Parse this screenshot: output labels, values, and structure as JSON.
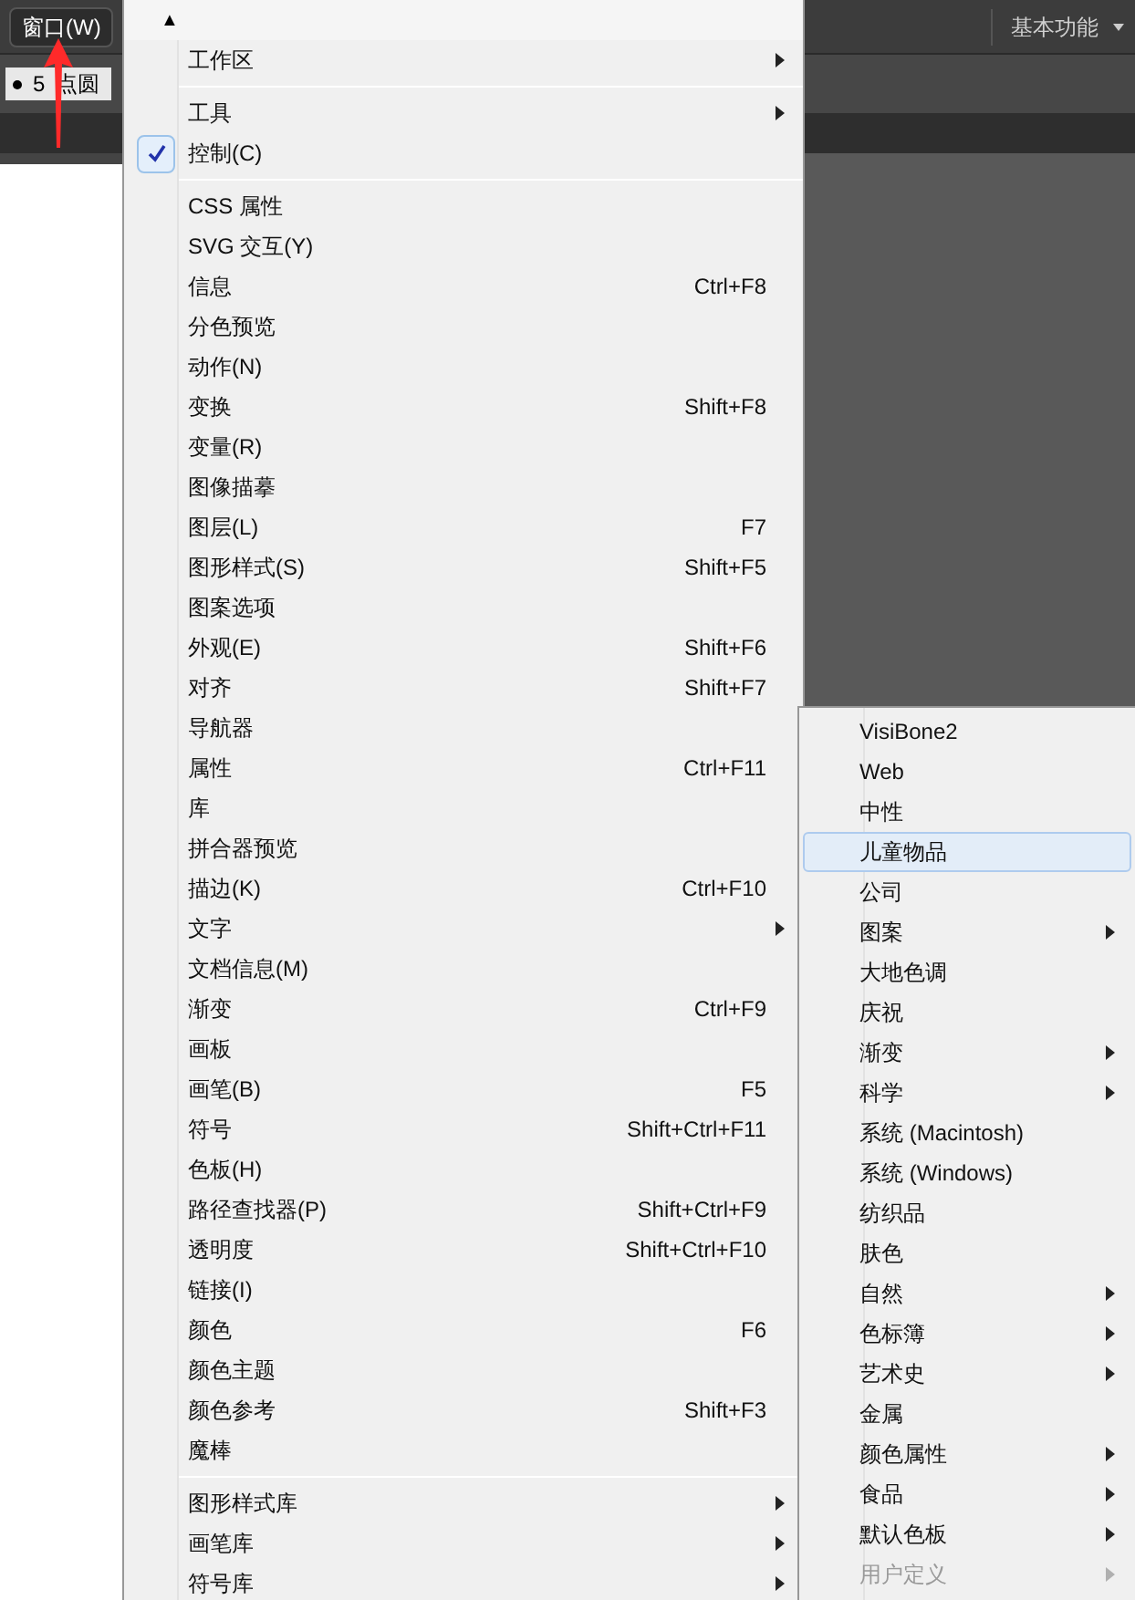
{
  "menu_button": {
    "label": "窗口(W)"
  },
  "control_field": {
    "size": "5",
    "shape": "点圆"
  },
  "workspace": {
    "label": "基本功能"
  },
  "menu": {
    "scroll_up": "▲",
    "sections": [
      {
        "items": [
          {
            "label": "工作区",
            "kind": "submenu"
          }
        ]
      },
      {
        "items": [
          {
            "label": "工具",
            "kind": "submenu"
          },
          {
            "label": "控制(C)",
            "kind": "item",
            "checked": true
          }
        ]
      },
      {
        "items": [
          {
            "label": "CSS 属性",
            "kind": "item",
            "checked": false
          },
          {
            "label": "SVG 交互(Y)",
            "kind": "item",
            "checked": false
          },
          {
            "label": "信息",
            "shortcut": "Ctrl+F8",
            "kind": "item",
            "checked": false
          },
          {
            "label": "分色预览",
            "kind": "item",
            "checked": false
          },
          {
            "label": "动作(N)",
            "kind": "item",
            "checked": false
          },
          {
            "label": "变换",
            "shortcut": "Shift+F8",
            "kind": "item",
            "checked": false
          },
          {
            "label": "变量(R)",
            "kind": "item",
            "checked": false
          },
          {
            "label": "图像描摹",
            "kind": "item",
            "checked": false
          },
          {
            "label": "图层(L)",
            "shortcut": "F7",
            "kind": "item",
            "checked": false
          },
          {
            "label": "图形样式(S)",
            "shortcut": "Shift+F5",
            "kind": "item",
            "checked": false
          },
          {
            "label": "图案选项",
            "kind": "item",
            "checked": false
          },
          {
            "label": "外观(E)",
            "shortcut": "Shift+F6",
            "kind": "item",
            "checked": false
          },
          {
            "label": "对齐",
            "shortcut": "Shift+F7",
            "kind": "item",
            "checked": false
          },
          {
            "label": "导航器",
            "kind": "item",
            "checked": false
          },
          {
            "label": "属性",
            "shortcut": "Ctrl+F11",
            "kind": "item",
            "checked": false
          },
          {
            "label": "库",
            "kind": "item",
            "checked": false
          },
          {
            "label": "拼合器预览",
            "kind": "item",
            "checked": false
          },
          {
            "label": "描边(K)",
            "shortcut": "Ctrl+F10",
            "kind": "item",
            "checked": false
          },
          {
            "label": "文字",
            "kind": "submenu"
          },
          {
            "label": "文档信息(M)",
            "kind": "item",
            "checked": false
          },
          {
            "label": "渐变",
            "shortcut": "Ctrl+F9",
            "kind": "item",
            "checked": false
          },
          {
            "label": "画板",
            "kind": "item",
            "checked": false
          },
          {
            "label": "画笔(B)",
            "shortcut": "F5",
            "kind": "item",
            "checked": false
          },
          {
            "label": "符号",
            "shortcut": "Shift+Ctrl+F11",
            "kind": "item",
            "checked": false
          },
          {
            "label": "色板(H)",
            "kind": "item",
            "checked": false
          },
          {
            "label": "路径查找器(P)",
            "shortcut": "Shift+Ctrl+F9",
            "kind": "item",
            "checked": false
          },
          {
            "label": "透明度",
            "shortcut": "Shift+Ctrl+F10",
            "kind": "item",
            "checked": false
          },
          {
            "label": "链接(I)",
            "kind": "item",
            "checked": false
          },
          {
            "label": "颜色",
            "shortcut": "F6",
            "kind": "item",
            "checked": false
          },
          {
            "label": "颜色主题",
            "kind": "item",
            "checked": false
          },
          {
            "label": "颜色参考",
            "shortcut": "Shift+F3",
            "kind": "item",
            "checked": false
          },
          {
            "label": "魔棒",
            "kind": "item",
            "checked": false
          }
        ]
      },
      {
        "items": [
          {
            "label": "图形样式库",
            "kind": "submenu"
          },
          {
            "label": "画笔库",
            "kind": "submenu"
          },
          {
            "label": "符号库",
            "kind": "submenu"
          }
        ]
      }
    ]
  },
  "submenu": {
    "items": [
      {
        "label": "VisiBone2",
        "kind": "item",
        "selected": false,
        "disabled": false
      },
      {
        "label": "Web",
        "kind": "item",
        "selected": false,
        "disabled": false
      },
      {
        "label": "中性",
        "kind": "item",
        "selected": false,
        "disabled": false
      },
      {
        "label": "儿童物品",
        "kind": "item",
        "selected": true,
        "disabled": false
      },
      {
        "label": "公司",
        "kind": "item",
        "selected": false,
        "disabled": false
      },
      {
        "label": "图案",
        "kind": "submenu",
        "selected": false,
        "disabled": false
      },
      {
        "label": "大地色调",
        "kind": "item",
        "selected": false,
        "disabled": false
      },
      {
        "label": "庆祝",
        "kind": "item",
        "selected": false,
        "disabled": false
      },
      {
        "label": "渐变",
        "kind": "submenu",
        "selected": false,
        "disabled": false
      },
      {
        "label": "科学",
        "kind": "submenu",
        "selected": false,
        "disabled": false
      },
      {
        "label": "系统 (Macintosh)",
        "kind": "item",
        "selected": false,
        "disabled": false
      },
      {
        "label": "系统 (Windows)",
        "kind": "item",
        "selected": false,
        "disabled": false
      },
      {
        "label": "纺织品",
        "kind": "item",
        "selected": false,
        "disabled": false
      },
      {
        "label": "肤色",
        "kind": "item",
        "selected": false,
        "disabled": false
      },
      {
        "label": "自然",
        "kind": "submenu",
        "selected": false,
        "disabled": false
      },
      {
        "label": "色标簿",
        "kind": "submenu",
        "selected": false,
        "disabled": false
      },
      {
        "label": "艺术史",
        "kind": "submenu",
        "selected": false,
        "disabled": false
      },
      {
        "label": "金属",
        "kind": "item",
        "selected": false,
        "disabled": false
      },
      {
        "label": "颜色属性",
        "kind": "submenu",
        "selected": false,
        "disabled": false
      },
      {
        "label": "食品",
        "kind": "submenu",
        "selected": false,
        "disabled": false
      },
      {
        "label": "默认色板",
        "kind": "submenu",
        "selected": false,
        "disabled": false
      },
      {
        "label": "用户定义",
        "kind": "submenu",
        "selected": false,
        "disabled": true
      }
    ]
  }
}
